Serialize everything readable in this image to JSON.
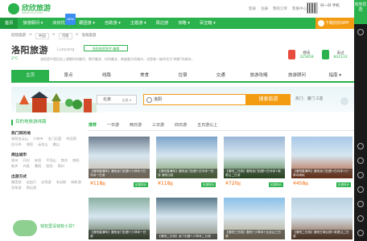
{
  "site": {
    "name": "欣欣旅游",
    "domain": "www.cncn.com"
  },
  "top_links": [
    "登录",
    "注册",
    "我的订单",
    "客服中心"
  ],
  "scan_text": "扫一扫 手机",
  "nav": [
    {
      "label": "首页"
    },
    {
      "label": "旅游顾问 ▾"
    },
    {
      "label": "欣欣优选",
      "badge": "NEW"
    },
    {
      "label": "跟团游 ▾"
    },
    {
      "label": "自助游 ▾"
    },
    {
      "label": "主题游 ▾"
    },
    {
      "label": "周边游"
    },
    {
      "label": "攻略 ▾"
    },
    {
      "label": "百宝箱 ▾"
    }
  ],
  "download_app": "下载欣欣APP",
  "breadcrumb": [
    "欣欣旅游",
    "中国",
    "河南",
    "洛阳旅游"
  ],
  "city": {
    "name": "洛阳旅游",
    "en": "Luoyang",
    "edit": "洛阳旅游宣传 编辑",
    "weather": "2°C",
    "desc": "洛阳是中国历史上建都时间最早、朝代最多、时间最长、跨度最大的城市，也是唯一被命名为\"神都\"的城市。",
    "stats": [
      {
        "label": "想去",
        "value": "325858",
        "color": "#e74c3c"
      },
      {
        "label": "去过",
        "value": "842133",
        "color": "#2bb24c"
      }
    ]
  },
  "tabs": [
    "主页",
    "景点",
    "线路",
    "美食",
    "住宿",
    "交通",
    "旅游攻略",
    "旅游顾问",
    "指南 ▾"
  ],
  "search": {
    "from": "北京",
    "from_dd": "出发 ▾",
    "query": "洛阳",
    "button": "搜索旅游",
    "hot": "热门： 厦门  三亚"
  },
  "left_panel": {
    "title": "目的地旅游线路",
    "sections": [
      {
        "heading": "热门目的地",
        "items": [
          "洛阳白云山",
          "少林寺",
          "龙门石窟",
          "鸡冠洞",
          "白马寺",
          "洛阳",
          "云台山",
          "嵩山"
        ]
      },
      {
        "heading": "周边城市",
        "items": [
          "郑州",
          "开封",
          "安阳",
          "平顶山",
          "焦作",
          "南阳",
          "新乡",
          "许昌",
          "濮阳",
          "信阳",
          "周口"
        ]
      },
      {
        "heading": "出游方式",
        "items": [
          "跟团游",
          "自由行",
          "自驾游",
          "半自助",
          "邮轮游",
          "包车游",
          "周边游"
        ]
      }
    ],
    "promo": "钱包里没钱有小贷？"
  },
  "filters": [
    "推荐",
    "一日游",
    "两日游",
    "三日游",
    "四日游",
    "五日游以上"
  ],
  "cards": [
    {
      "cap": "【洛阳直通车】洛阳龙门石窟+少林寺+白马寺一日游",
      "price": "¥118",
      "unit": "起",
      "tag": "优惠特价",
      "c1": "#6f7f8f",
      "c2": "#c9b59a"
    },
    {
      "cap": "【洛阳直通车】洛阳龙门石窟+白马寺一日游 洛阳出发",
      "price": "¥118",
      "unit": "起",
      "tag": "优惠特价",
      "c1": "#7aa2c9",
      "c2": "#7a9a5a"
    },
    {
      "cap": "【洛阳二日游】洛阳龙门石窟+白马寺+老君山二日游",
      "price": "¥720",
      "unit": "起",
      "tag": "优惠特价",
      "c1": "#9ab7d6",
      "c2": "#4a7a3a"
    },
    {
      "cap": "【洛阳直通车】洛阳龙门石窟+白马寺+少林寺纯玩",
      "price": "¥458",
      "unit": "起",
      "tag": "优惠特价",
      "c1": "#a9c8e8",
      "c2": "#b5562c"
    },
    {
      "cap": "【洛阳直通车】洛阳龙门石窟+少林寺一日游",
      "price": "",
      "unit": "",
      "tag": "",
      "c1": "#8ab0a0",
      "c2": "#5a6a4a"
    },
    {
      "cap": "【洛阳二日游】龙门石窟+少林寺二日游",
      "price": "",
      "unit": "",
      "tag": "",
      "c1": "#5a7a8a",
      "c2": "#8a8a7a"
    },
    {
      "cap": "【洛阳三日游】洛阳+少林寺+云台山三日游",
      "price": "",
      "unit": "",
      "tag": "",
      "c1": "#8ac0e8",
      "c2": "#b0a080"
    },
    {
      "cap": "【洛阳二日游】洛阳王城公园+老君山二日游",
      "price": "",
      "unit": "",
      "tag": "",
      "c1": "#b8d0e0",
      "c2": "#8a5a3a"
    }
  ],
  "rail": {
    "top": "欣欣优选"
  }
}
